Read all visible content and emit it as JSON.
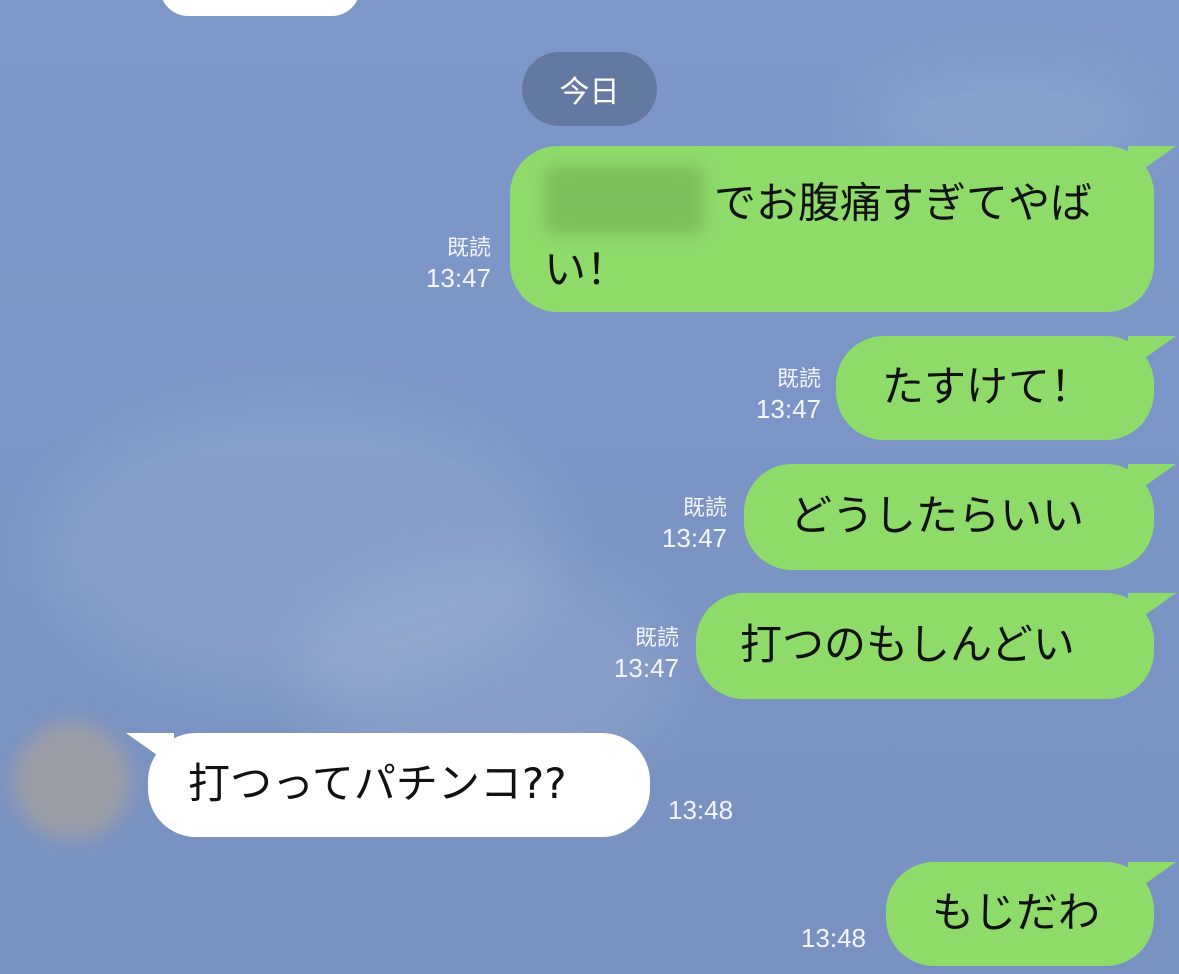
{
  "date_separator": "今日",
  "messages": [
    {
      "direction": "out",
      "text": "でお腹痛すぎてやばい！",
      "read": "既読",
      "time": "13:47",
      "redacted_prefix": true
    },
    {
      "direction": "out",
      "text": "たすけて！",
      "read": "既読",
      "time": "13:47"
    },
    {
      "direction": "out",
      "text": "どうしたらいい",
      "read": "既読",
      "time": "13:47"
    },
    {
      "direction": "out",
      "text": "打つのもしんどい",
      "read": "既読",
      "time": "13:47"
    },
    {
      "direction": "in",
      "text": "打つってパチンコ??",
      "time": "13:48"
    },
    {
      "direction": "out",
      "text": "もじだわ",
      "time": "13:48"
    }
  ],
  "colors": {
    "background": "#7b95c6",
    "outgoing_bubble": "#8fdb6a",
    "incoming_bubble": "#ffffff",
    "date_pill": "#6479a1"
  }
}
